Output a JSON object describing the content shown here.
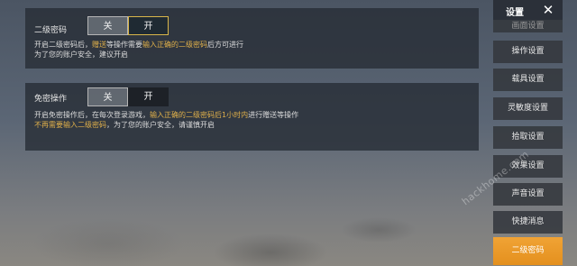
{
  "settings_panels": [
    {
      "label": "二级密码",
      "toggle": {
        "off_label": "关",
        "on_label": "开",
        "selected": "开"
      },
      "description": [
        [
          {
            "text": "开启二级密码后，",
            "highlight": false
          },
          {
            "text": "赠送",
            "highlight": true
          },
          {
            "text": "等操作需要",
            "highlight": false
          },
          {
            "text": "输入正确的二级密码",
            "highlight": true
          },
          {
            "text": "后方可进行",
            "highlight": false
          }
        ],
        [
          {
            "text": "为了您的账户安全，建议开启",
            "highlight": false
          }
        ]
      ]
    },
    {
      "label": "免密操作",
      "toggle": {
        "off_label": "关",
        "on_label": "开",
        "selected": "关"
      },
      "description": [
        [
          {
            "text": "开启免密操作后，在每次登录游戏，",
            "highlight": false
          },
          {
            "text": "输入正确的二级密码后1小时内",
            "highlight": true
          },
          {
            "text": "进行赠送等操作",
            "highlight": false
          }
        ],
        [
          {
            "text": "不再需要输入二级密码",
            "highlight": true
          },
          {
            "text": "，为了您的账户安全，请谨慎开启",
            "highlight": false
          }
        ]
      ]
    }
  ],
  "sidebar": {
    "title": "设置",
    "close_icon": "close-icon",
    "partial_item": "画面设置",
    "items": [
      "操作设置",
      "载具设置",
      "灵敏度设置",
      "拾取设置",
      "效果设置",
      "声音设置",
      "快捷消息",
      "二级密码"
    ],
    "active_item": "二级密码"
  },
  "watermark": "hackhome.com",
  "colors": {
    "highlight": "#e0b04a",
    "active_tab": "#e4901e",
    "toggle_on_border": "#d9b64a"
  }
}
